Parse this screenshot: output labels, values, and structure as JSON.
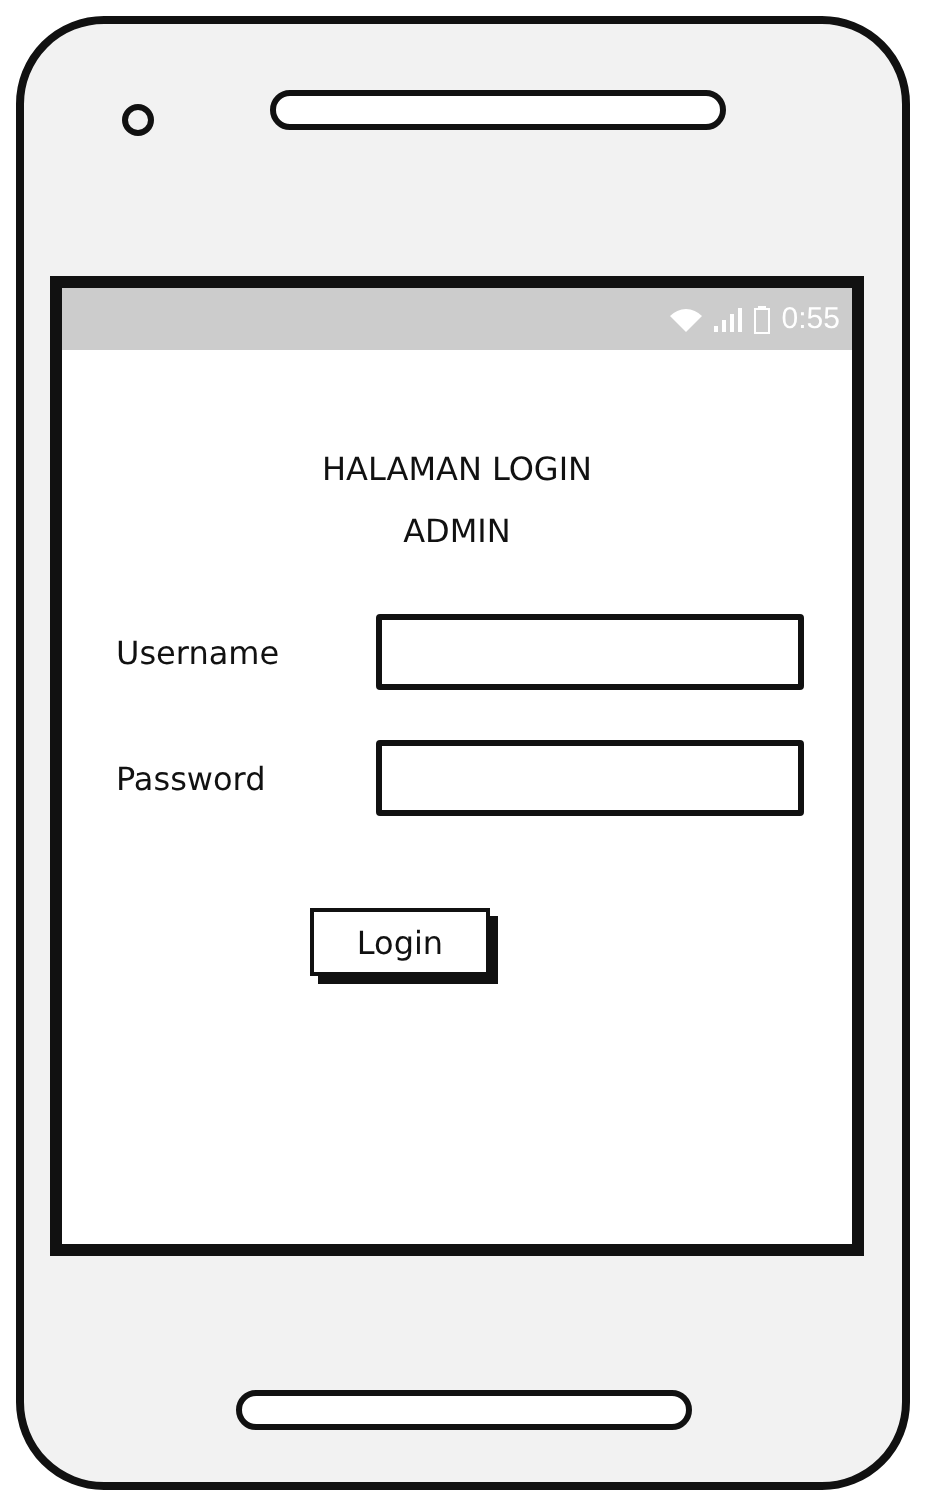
{
  "status_bar": {
    "time": "0:55"
  },
  "title_lines": [
    "HALAMAN LOGIN",
    "ADMIN"
  ],
  "fields": [
    {
      "label": "Username"
    },
    {
      "label": "Password"
    }
  ],
  "button": "Login"
}
